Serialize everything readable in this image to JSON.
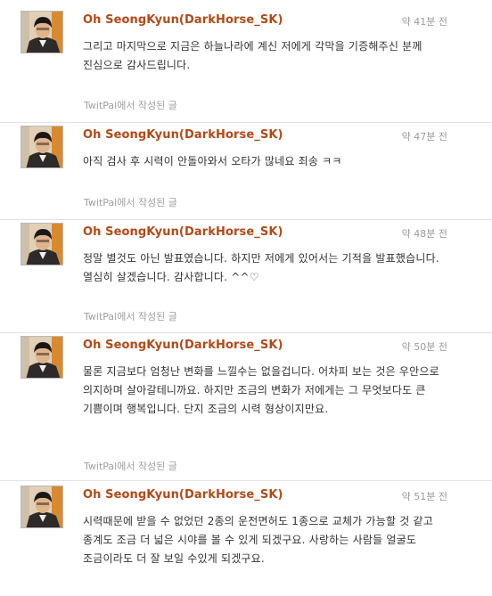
{
  "feed": {
    "tweets": [
      {
        "author": "Oh SeongKyun(DarkHorse_SK)",
        "time": "약 41분 전",
        "text": "그리고 마지막으로 지금은 하늘나라에 계신 저에게 각막을 기증해주신 분께 진심으로 감사드립니다.",
        "source_app": "TwitPal",
        "source_suffix": "에서 작성된 글"
      },
      {
        "author": "Oh SeongKyun(DarkHorse_SK)",
        "time": "약 47분 전",
        "text": "아직 검사 후 시력이 안돌아와서 오타가 많네요 죄송 ㅋㅋ",
        "source_app": "TwitPal",
        "source_suffix": "에서 작성된 글"
      },
      {
        "author": "Oh SeongKyun(DarkHorse_SK)",
        "time": "약 48분 전",
        "text": "정말 별것도 아닌 발표였습니다. 하지만 저에게 있어서는 기적을 발표했습니다. 열심히 살겠습니다. 감사합니다. ^^♡",
        "source_app": "TwitPal",
        "source_suffix": "에서 작성된 글"
      },
      {
        "author": "Oh SeongKyun(DarkHorse_SK)",
        "time": "약 50분 전",
        "text": "물론 지금보다 엄청난 변화를 느낄수는 없을겁니다. 어차피 보는 것은 우안으로 의지하며 살아갈테니까요. 하지만 조금의 변화가 저에게는 그 무엇보다도 큰 기쁨이며 행복입니다. 단지 조금의 시력 형상이지만요.",
        "source_app": "TwitPal",
        "source_suffix": "에서 작성된 글"
      },
      {
        "author": "Oh SeongKyun(DarkHorse_SK)",
        "time": "약 51분 전",
        "text": "시력때문에 받을 수 없었던 2종의 운전면허도 1종으로 교체가 가능할 것 같고 종계도 조금 더 넓은 시야를 볼 수 있게 되겠구요. 사랑하는 사람들 얼굴도 조금이라도 더 잘 보일 수있게 되겠구요.",
        "source_app": "",
        "source_suffix": ""
      }
    ]
  }
}
